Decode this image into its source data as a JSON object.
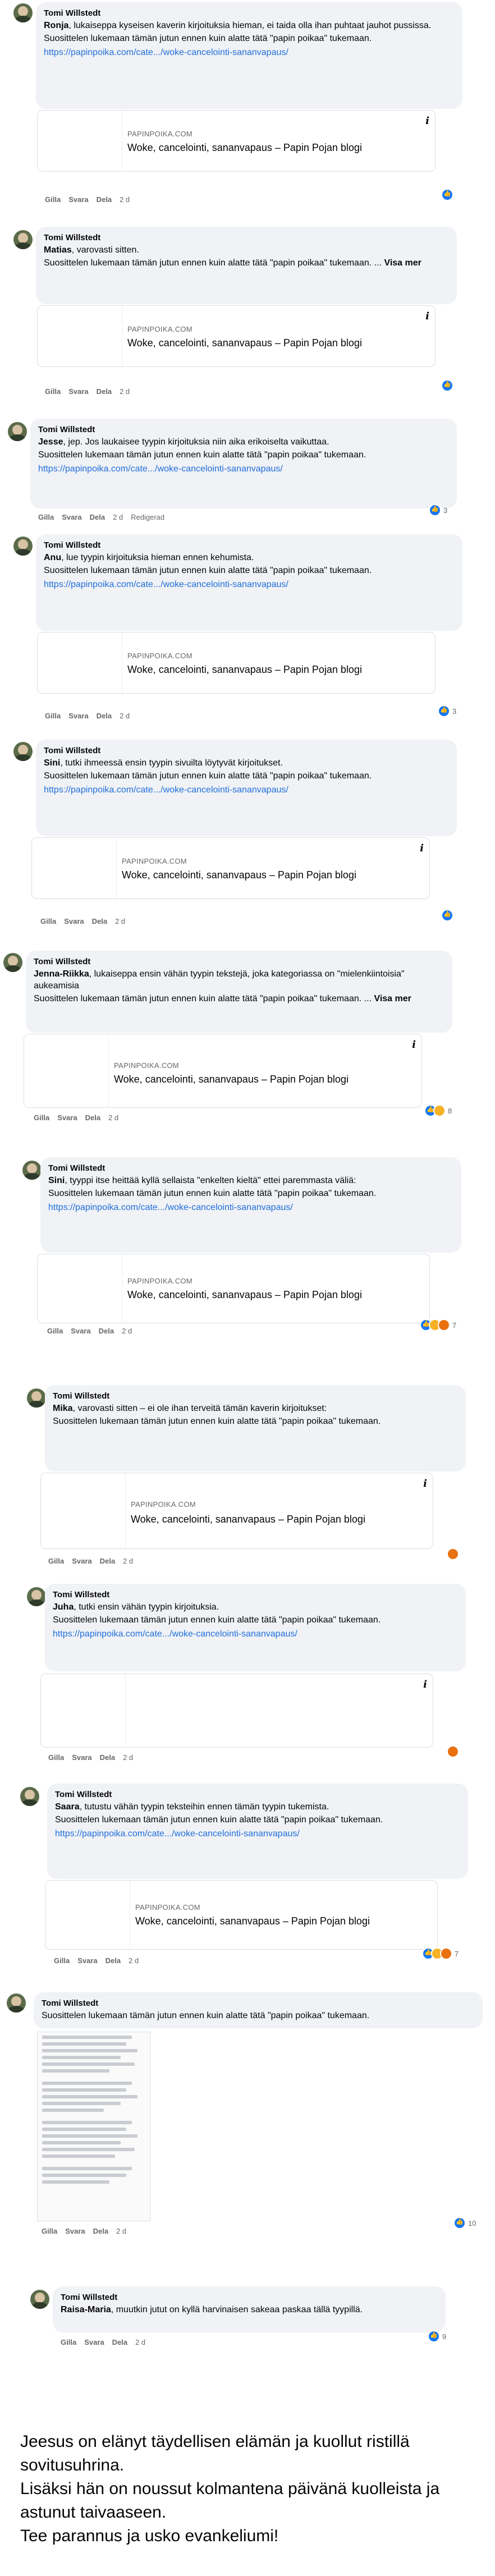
{
  "preview": {
    "domain": "PAPINPOIKA.COM",
    "title": "Woke, cancelointi, sananvapaus – Papin Pojan blogi",
    "info": "i"
  },
  "common": {
    "author": "Tomi Willstedt",
    "rec_text": "Suosittelen lukemaan tämän jutun ennen kuin alatte tätä \"papin poikaa\" tukemaan.",
    "link": "https://papinpoika.com/cate.../woke-cancelointi-sananvapaus/",
    "like": "Gilla",
    "reply": "Svara",
    "share": "Dela",
    "time": "2 d",
    "edited": "Redigerad",
    "see_more": "Visa mer"
  },
  "comments": [
    {
      "mention": "Ronja",
      "text": ", lukaiseppa kyseisen kaverin kirjoituksia hieman, ei taida olla ihan puhtaat jauhot pussissa."
    },
    {
      "mention": "Matias",
      "text": ", varovasti sitten."
    },
    {
      "mention": "Jesse",
      "text": ", jep. Jos laukaisee tyypin kirjoituksia niin aika erikoiselta vaikuttaa.",
      "count": "3"
    },
    {
      "mention": "Anu",
      "text": ", lue tyypin kirjoituksia hieman ennen kehumista.",
      "count": "3"
    },
    {
      "mention": "Sini",
      "text": ", tutki ihmeessä ensin tyypin sivuilta löytyvät kirjoitukset."
    },
    {
      "mention": "Jenna-Riikka",
      "text": ", lukaiseppa ensin vähän tyypin tekstejä, joka kategoriassa on \"mielenkiintoisia\" aukeamisia",
      "count": "8"
    },
    {
      "mention": "Sini",
      "text": ", tyyppi itse heittää kyllä sellaista \"enkelten kieltä\" ettei paremmasta väliä:",
      "count": "7"
    },
    {
      "mention": "Mika",
      "text": ", varovasti sitten – ei ole ihan terveitä tämän kaverin kirjoitukset:"
    },
    {
      "mention": "Juha",
      "text": ", tutki ensin vähän tyypin kirjoituksia."
    },
    {
      "mention": "Saara",
      "text": ", tutustu vähän tyypin teksteihin ennen tämän tyypin tukemista.",
      "count": "7"
    },
    {
      "count": "10"
    },
    {
      "mention": "Raisa-Maria",
      "text": ", muutkin jutut on kyllä harvinaisen sakeaa paskaa tällä tyypillä.",
      "count": "9"
    }
  ],
  "footer": {
    "line1": "Jeesus on elänyt täydellisen elämän ja kuollut ristillä sovitusuhrina.",
    "line2": "Lisäksi hän on noussut kolmantena päivänä kuolleista ja astunut taivaaseen.",
    "line3": "Tee parannus ja usko evankeliumi!"
  }
}
